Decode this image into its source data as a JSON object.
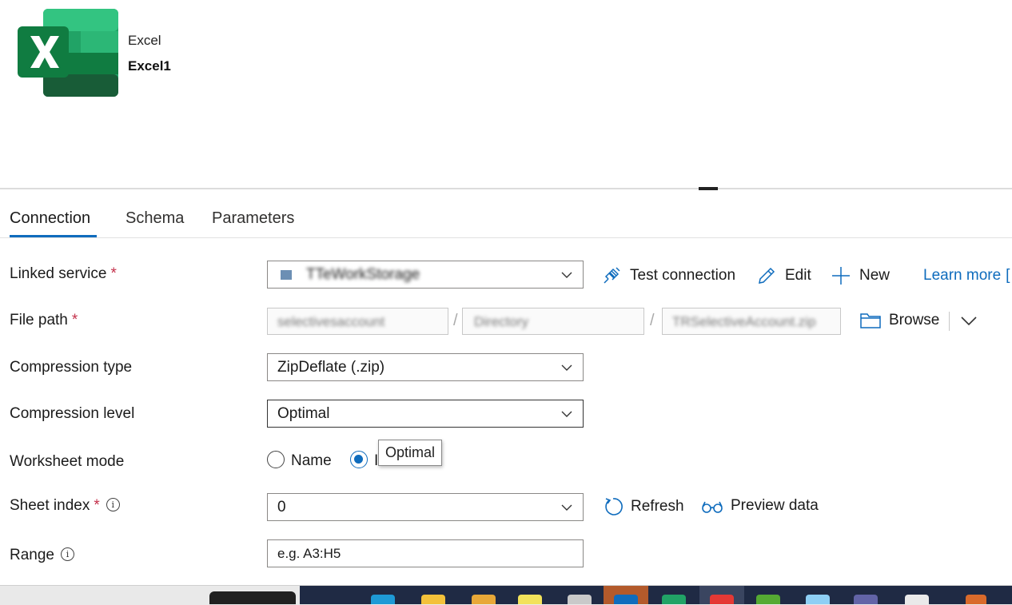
{
  "dataset": {
    "type": "Excel",
    "name": "Excel1"
  },
  "tabs": [
    {
      "label": "Connection",
      "active": true
    },
    {
      "label": "Schema",
      "active": false
    },
    {
      "label": "Parameters",
      "active": false
    }
  ],
  "form": {
    "linked_service": {
      "label": "Linked service",
      "required": "*",
      "value": "TTeWorkStorage"
    },
    "actions": {
      "test_connection": "Test connection",
      "edit": "Edit",
      "new": "New",
      "learn_more": "Learn more"
    },
    "file_path": {
      "label": "File path",
      "required": "*",
      "container": "selectivesaccount",
      "directory": "Directory",
      "file": "TRSelectiveAccount.zip",
      "separator": "/",
      "browse": "Browse"
    },
    "compression_type": {
      "label": "Compression type",
      "value": "ZipDeflate (.zip)"
    },
    "compression_level": {
      "label": "Compression level",
      "value": "Optimal"
    },
    "worksheet_mode": {
      "label": "Worksheet mode",
      "option_name": "Name",
      "option_index": "I"
    },
    "tooltip": "Optimal",
    "sheet_index": {
      "label": "Sheet index",
      "required": "*",
      "value": "0",
      "refresh": "Refresh",
      "preview": "Preview data"
    },
    "range": {
      "label": "Range",
      "placeholder": "e.g. A3:H5"
    }
  },
  "colors": {
    "accent": "#0f6cbd",
    "required": "#c4314b",
    "excel_green": "#107c41"
  }
}
